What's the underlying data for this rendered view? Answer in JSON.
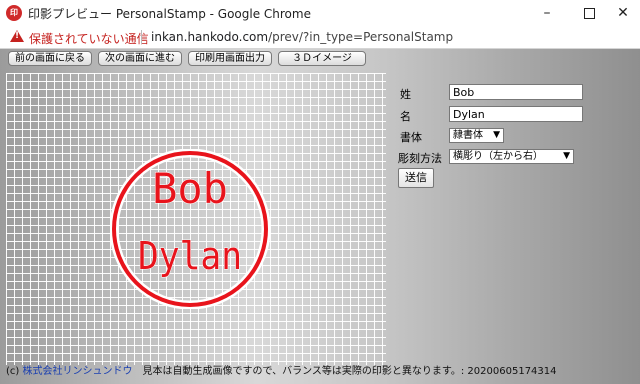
{
  "window": {
    "icon_text": "印",
    "title": "印影プレビュー PersonalStamp - Google Chrome",
    "min_glyph": "–",
    "close_glyph": "✕"
  },
  "address_bar": {
    "security_text": "保護されていない通信",
    "url_host": "inkan.hankodo.com",
    "url_path": "/prev/?in_type=PersonalStamp"
  },
  "nav_buttons": {
    "prev": "前の画面に戻る",
    "next": "次の画面に進む",
    "print": "印刷用画面出力",
    "view3d": "３Ｄイメージ"
  },
  "stamp": {
    "line1": "Bob",
    "line2": "Dylan",
    "color": "#e8141c"
  },
  "form": {
    "surname_label": "姓",
    "surname_value": "Bob",
    "name_label": "名",
    "name_value": "Dylan",
    "font_label": "書体",
    "font_value": "隷書体",
    "engrave_label": "彫刻方法",
    "engrave_value": "横彫り（左から右）",
    "submit": "送信"
  },
  "footer": {
    "copyright_prefix": "(c) ",
    "company": "株式会社リンシュンドウ",
    "notice": "見本は自動生成画像ですので、バランス等は実際の印影と異なります。: 20200605174314"
  }
}
